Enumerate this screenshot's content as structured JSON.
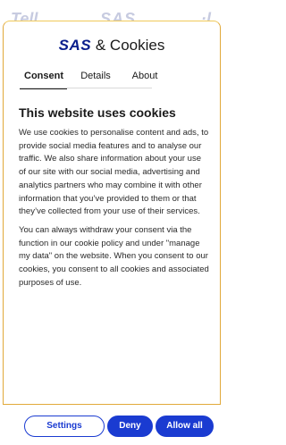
{
  "backdrop": {
    "left_text": "Tell",
    "logo_text": "SAS",
    "right_text": "·l"
  },
  "dialog": {
    "logo": "SAS",
    "title_suffix": "& Cookies",
    "tabs": [
      {
        "label": "Consent",
        "active": true
      },
      {
        "label": "Details",
        "active": false
      },
      {
        "label": "About",
        "active": false
      }
    ],
    "heading": "This website uses cookies",
    "paragraphs": [
      "We use cookies to personalise content and ads, to provide social media features and to analyse our traffic. We also share information about your use of our site with our social media, advertising and analytics partners who may combine it with other information that you’ve provided to them or that they’ve collected from your use of their services.",
      "You can always withdraw your consent via the function in our cookie policy and under \"manage my data\" on the website. When you consent to our cookies, you consent to all cookies and associated purposes of use."
    ]
  },
  "buttons": {
    "settings": "Settings",
    "deny": "Deny",
    "allow_all": "Allow all"
  },
  "colors": {
    "brand_blue": "#1a3bd1",
    "logo_navy": "#0a1e8c",
    "dialog_border": "#e1a93a"
  }
}
